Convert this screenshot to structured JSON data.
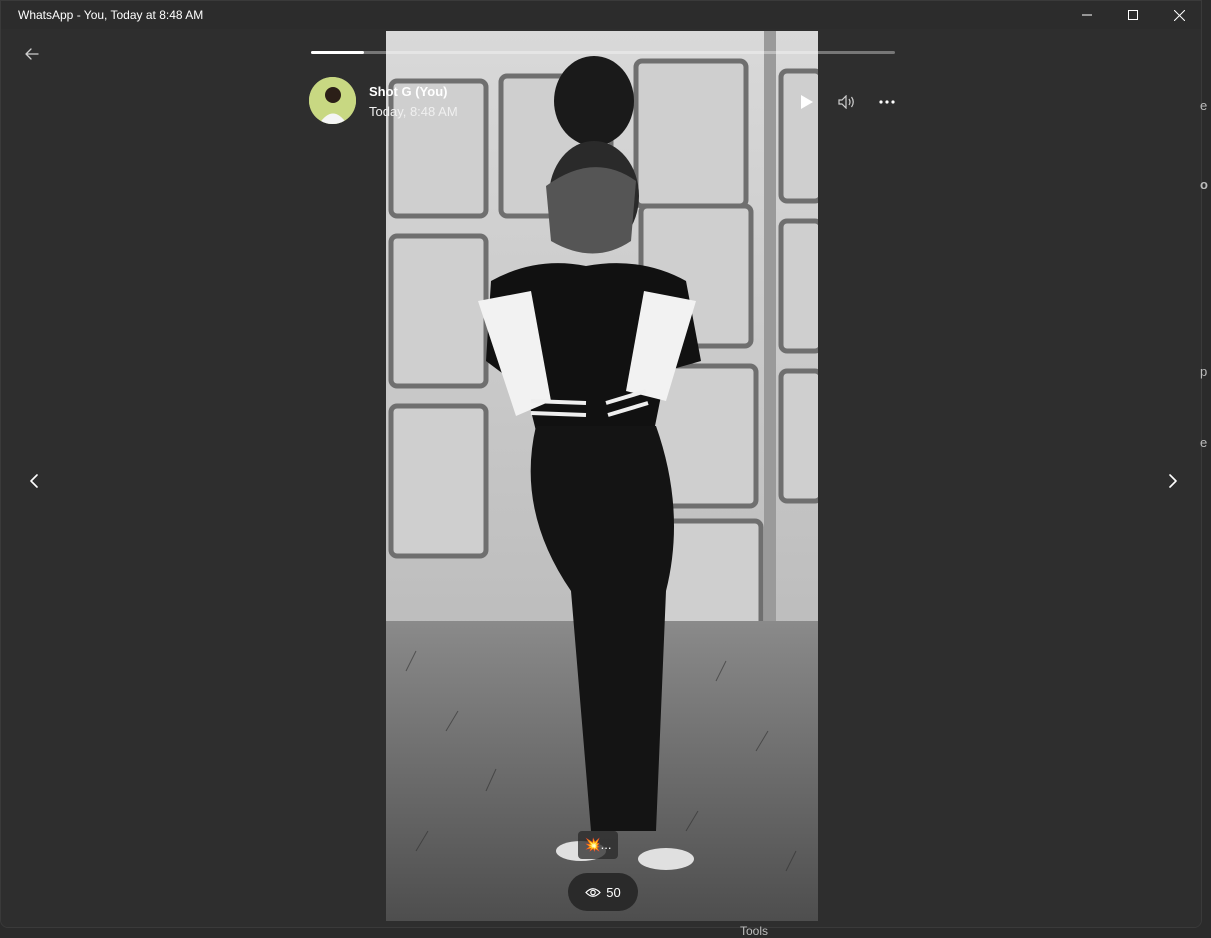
{
  "window": {
    "title": "WhatsApp - You, Today at 8:48 AM"
  },
  "status": {
    "user_name": "Shot G (You)",
    "timestamp": "Today, 8:48 AM",
    "progress": 0.09,
    "caption": "💥...",
    "view_count": "50"
  },
  "icons": {
    "back": "arrow-left-icon",
    "prev": "chevron-left-icon",
    "next": "chevron-right-icon",
    "play": "play-icon",
    "sound": "speaker-icon",
    "more": "ellipsis-icon",
    "views": "eye-icon"
  },
  "background_partial_text": {
    "t1": "e",
    "t2": "o",
    "t3": "p",
    "t4": "e",
    "bottom": "Tools"
  }
}
